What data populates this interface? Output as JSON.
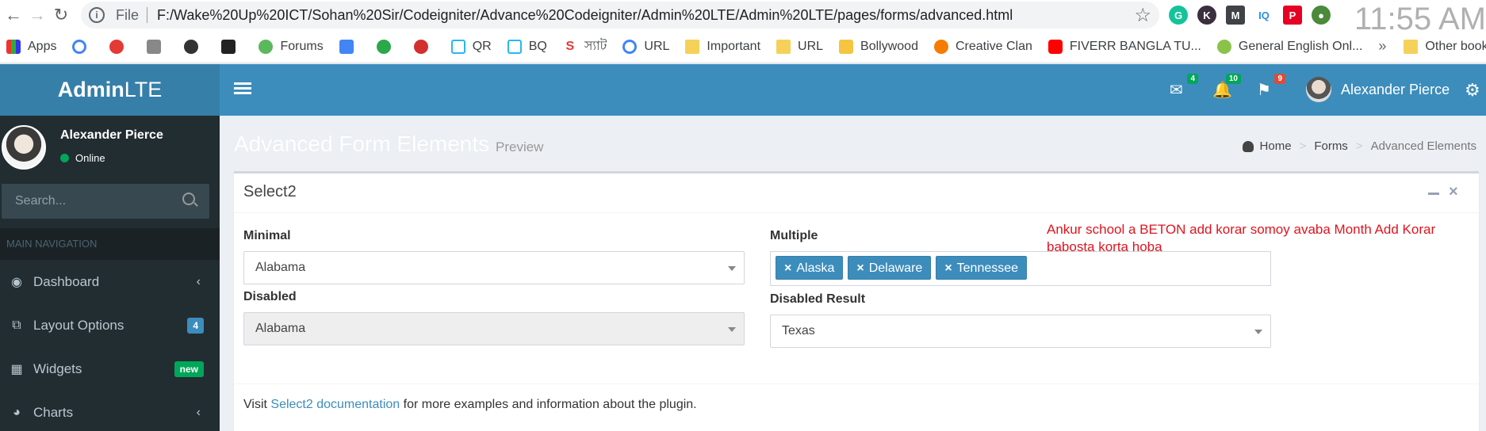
{
  "browser": {
    "file_label": "File",
    "url": "F:/Wake%20Up%20ICT/Sohan%20Sir/Codeigniter/Advance%20Codeigniter/Admin%20LTE/Admin%20LTE/pages/forms/advanced.html",
    "clock": "11:55 AM",
    "bookmarks": [
      "Apps",
      "Forums",
      "QR",
      "BQ",
      "স্যাট",
      "URL",
      "Important",
      "URL",
      "Bollywood",
      "Creative Clan",
      "FIVERR BANGLA TU...",
      "General English Onl..."
    ],
    "bookmarks_more": "»",
    "other_bookmarks": "Other bookmarks"
  },
  "logo": {
    "bold": "Admin",
    "rest": "LTE"
  },
  "header": {
    "messages_count": "4",
    "notifications_count": "10",
    "tasks_count": "9",
    "user_name": "Alexander Pierce"
  },
  "sidebar": {
    "user_name": "Alexander Pierce",
    "user_status": "Online",
    "search_placeholder": "Search...",
    "nav_header": "MAIN NAVIGATION",
    "items": [
      {
        "label": "Dashboard",
        "icon": "dashboard-icon"
      },
      {
        "label": "Layout Options",
        "icon": "files-icon",
        "badge": "4"
      },
      {
        "label": "Widgets",
        "icon": "th-icon",
        "badge": "new"
      },
      {
        "label": "Charts",
        "icon": "pie-chart-icon"
      }
    ]
  },
  "content": {
    "title": "Advanced Form Elements",
    "subtitle": "Preview",
    "breadcrumb": [
      "Home",
      "Forms",
      "Advanced Elements"
    ],
    "box_title": "Select2",
    "minimal_label": "Minimal",
    "minimal_value": "Alabama",
    "disabled_label": "Disabled",
    "disabled_value": "Alabama",
    "multiple_label": "Multiple",
    "multiple_tags": [
      "Alaska",
      "Delaware",
      "Tennessee"
    ],
    "disabled_result_label": "Disabled Result",
    "disabled_result_value": "Texas",
    "note": "Ankur school a BETON add korar somoy avaba Month Add Korar babosta korta hoba",
    "footer_prefix": "Visit",
    "footer_link": "Select2 documentation",
    "footer_suffix": "for more examples and information about the plugin."
  },
  "colors": {
    "header_blue": "#3c8dbc",
    "logo_blue": "#367fa9",
    "sidebar_dark": "#222d32",
    "note_red": "#e0141e"
  }
}
